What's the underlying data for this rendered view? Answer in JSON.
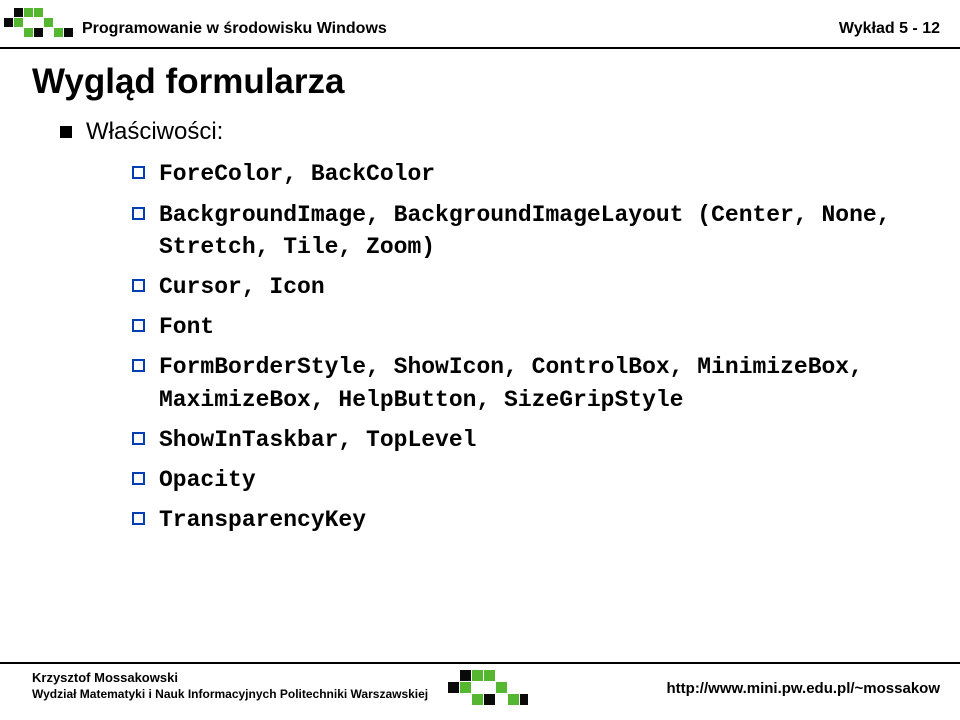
{
  "header": {
    "course": "Programowanie w środowisku Windows",
    "lecture": "Wykład 5 - 12"
  },
  "title": "Wygląd formularza",
  "bullets": {
    "level1": "Właściwości:",
    "items": [
      "ForeColor, BackColor",
      "BackgroundImage, BackgroundImageLayout (Center, None, Stretch, Tile, Zoom)",
      "Cursor, Icon",
      "Font",
      "FormBorderStyle, ShowIcon, ControlBox, MinimizeBox, MaximizeBox, HelpButton, SizeGripStyle",
      "ShowInTaskbar, TopLevel",
      "Opacity",
      "TransparencyKey"
    ]
  },
  "footer": {
    "author": "Krzysztof Mossakowski",
    "department": "Wydział Matematyki i Nauk Informacyjnych Politechniki Warszawskiej",
    "url": "http://www.mini.pw.edu.pl/~mossakow"
  },
  "colors": {
    "logo_green": "#55b730",
    "logo_dark": "#0a0a0a",
    "bullet_box": "#003eb3"
  }
}
